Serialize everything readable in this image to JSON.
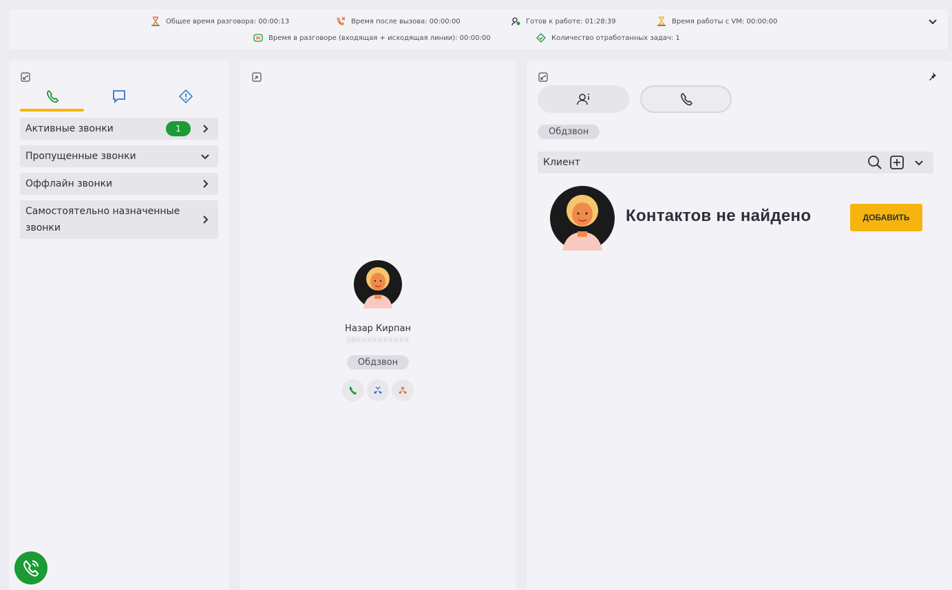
{
  "stats": {
    "total_talk": "Общее время разговора: 00:00:13",
    "after_call": "Время после вызова: 00:00:00",
    "ready": "Готов к работе: 01:28:39",
    "vm_time": "Время работы с VM: 00:00:00",
    "in_talk": "Время в разговоре (входящая + исходящая линии): 00:00:00",
    "tasks": "Количество отработанных задач: 1"
  },
  "left_panel": {
    "tabs": [
      {
        "icon": "phone-icon",
        "active": true
      },
      {
        "icon": "chat-icon",
        "active": false
      },
      {
        "icon": "alert-diamond-icon",
        "active": false
      }
    ],
    "items": [
      {
        "label": "Активные звонки",
        "badge": "1",
        "chevron": "chevron-right-icon"
      },
      {
        "label": "Пропущенные звонки",
        "chevron": "chevron-down-icon"
      },
      {
        "label": "Оффлайн звонки",
        "chevron": "chevron-right-icon"
      },
      {
        "label": "Самостоятельно назначенные звонки",
        "chevron": "chevron-right-icon"
      }
    ]
  },
  "call": {
    "name": "Назар Кирпан",
    "phone": "380XXXXXXXXX",
    "tag": "Обдзвон"
  },
  "right_panel": {
    "tag": "Обдзвон",
    "client_label": "Клиент",
    "not_found": "Контактов не найдено",
    "add_button": "ДОБАВИТЬ"
  },
  "colors": {
    "accent": "#f6b40e",
    "green": "#1a9b33",
    "blue": "#3a6fd8",
    "orange": "#e8672a"
  }
}
